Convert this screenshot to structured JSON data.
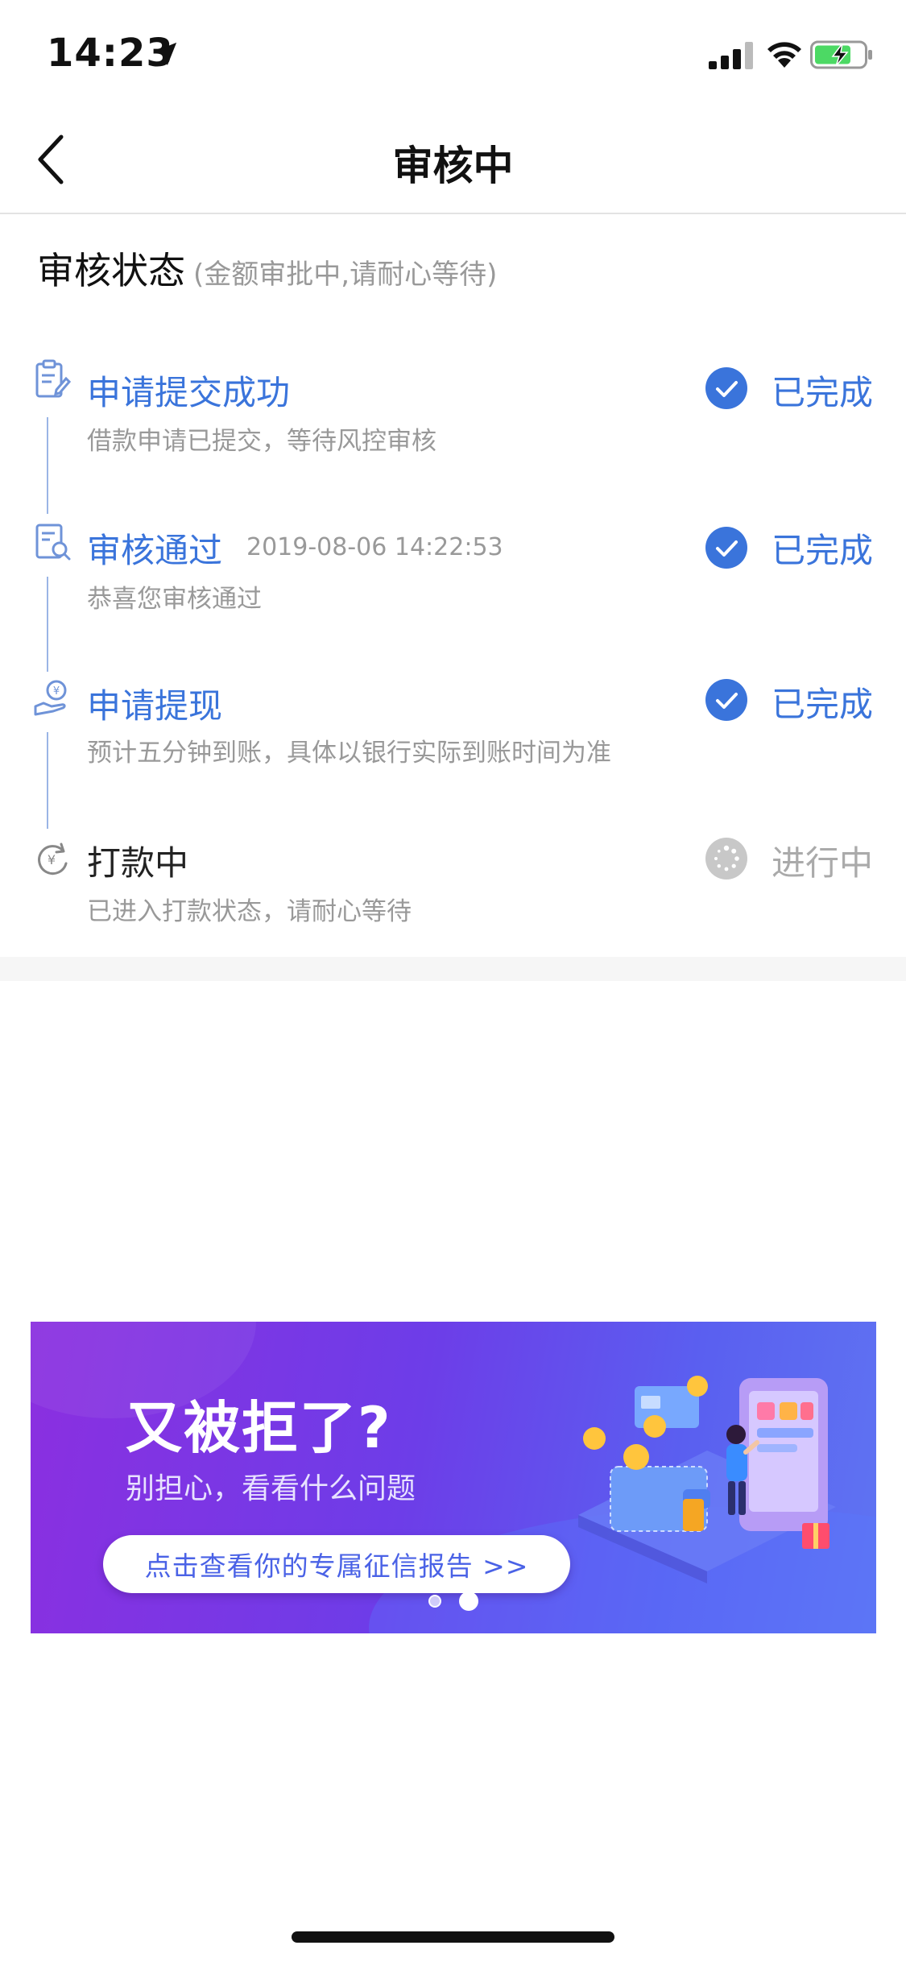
{
  "status_bar": {
    "time": "14:23"
  },
  "nav": {
    "title": "审核中"
  },
  "section": {
    "title": "审核状态",
    "subtitle": "(金额审批中,请耐心等待)"
  },
  "steps": [
    {
      "title": "申请提交成功",
      "time": "",
      "desc": "借款申请已提交，等待风控审核",
      "status": "已完成",
      "state": "done",
      "icon": "clipboard-edit-icon"
    },
    {
      "title": "审核通过",
      "time": "2019-08-06 14:22:53",
      "desc": "恭喜您审核通过",
      "status": "已完成",
      "state": "done",
      "icon": "document-search-icon"
    },
    {
      "title": "申请提现",
      "time": "",
      "desc": "预计五分钟到账，具体以银行实际到账时间为准",
      "status": "已完成",
      "state": "done",
      "icon": "hand-coin-icon"
    },
    {
      "title": "打款中",
      "time": "",
      "desc": "已进入打款状态，请耐心等待",
      "status": "进行中",
      "state": "pending",
      "icon": "yuan-refresh-icon"
    }
  ],
  "banner": {
    "title": "又被拒了?",
    "subtitle": "别担心，看看什么问题",
    "cta": "点击查看你的专属征信报告 >>",
    "pages": 2,
    "active_page": 2
  },
  "colors": {
    "accent": "#3a74db",
    "muted": "#999999",
    "pending": "#aaaaaa"
  }
}
